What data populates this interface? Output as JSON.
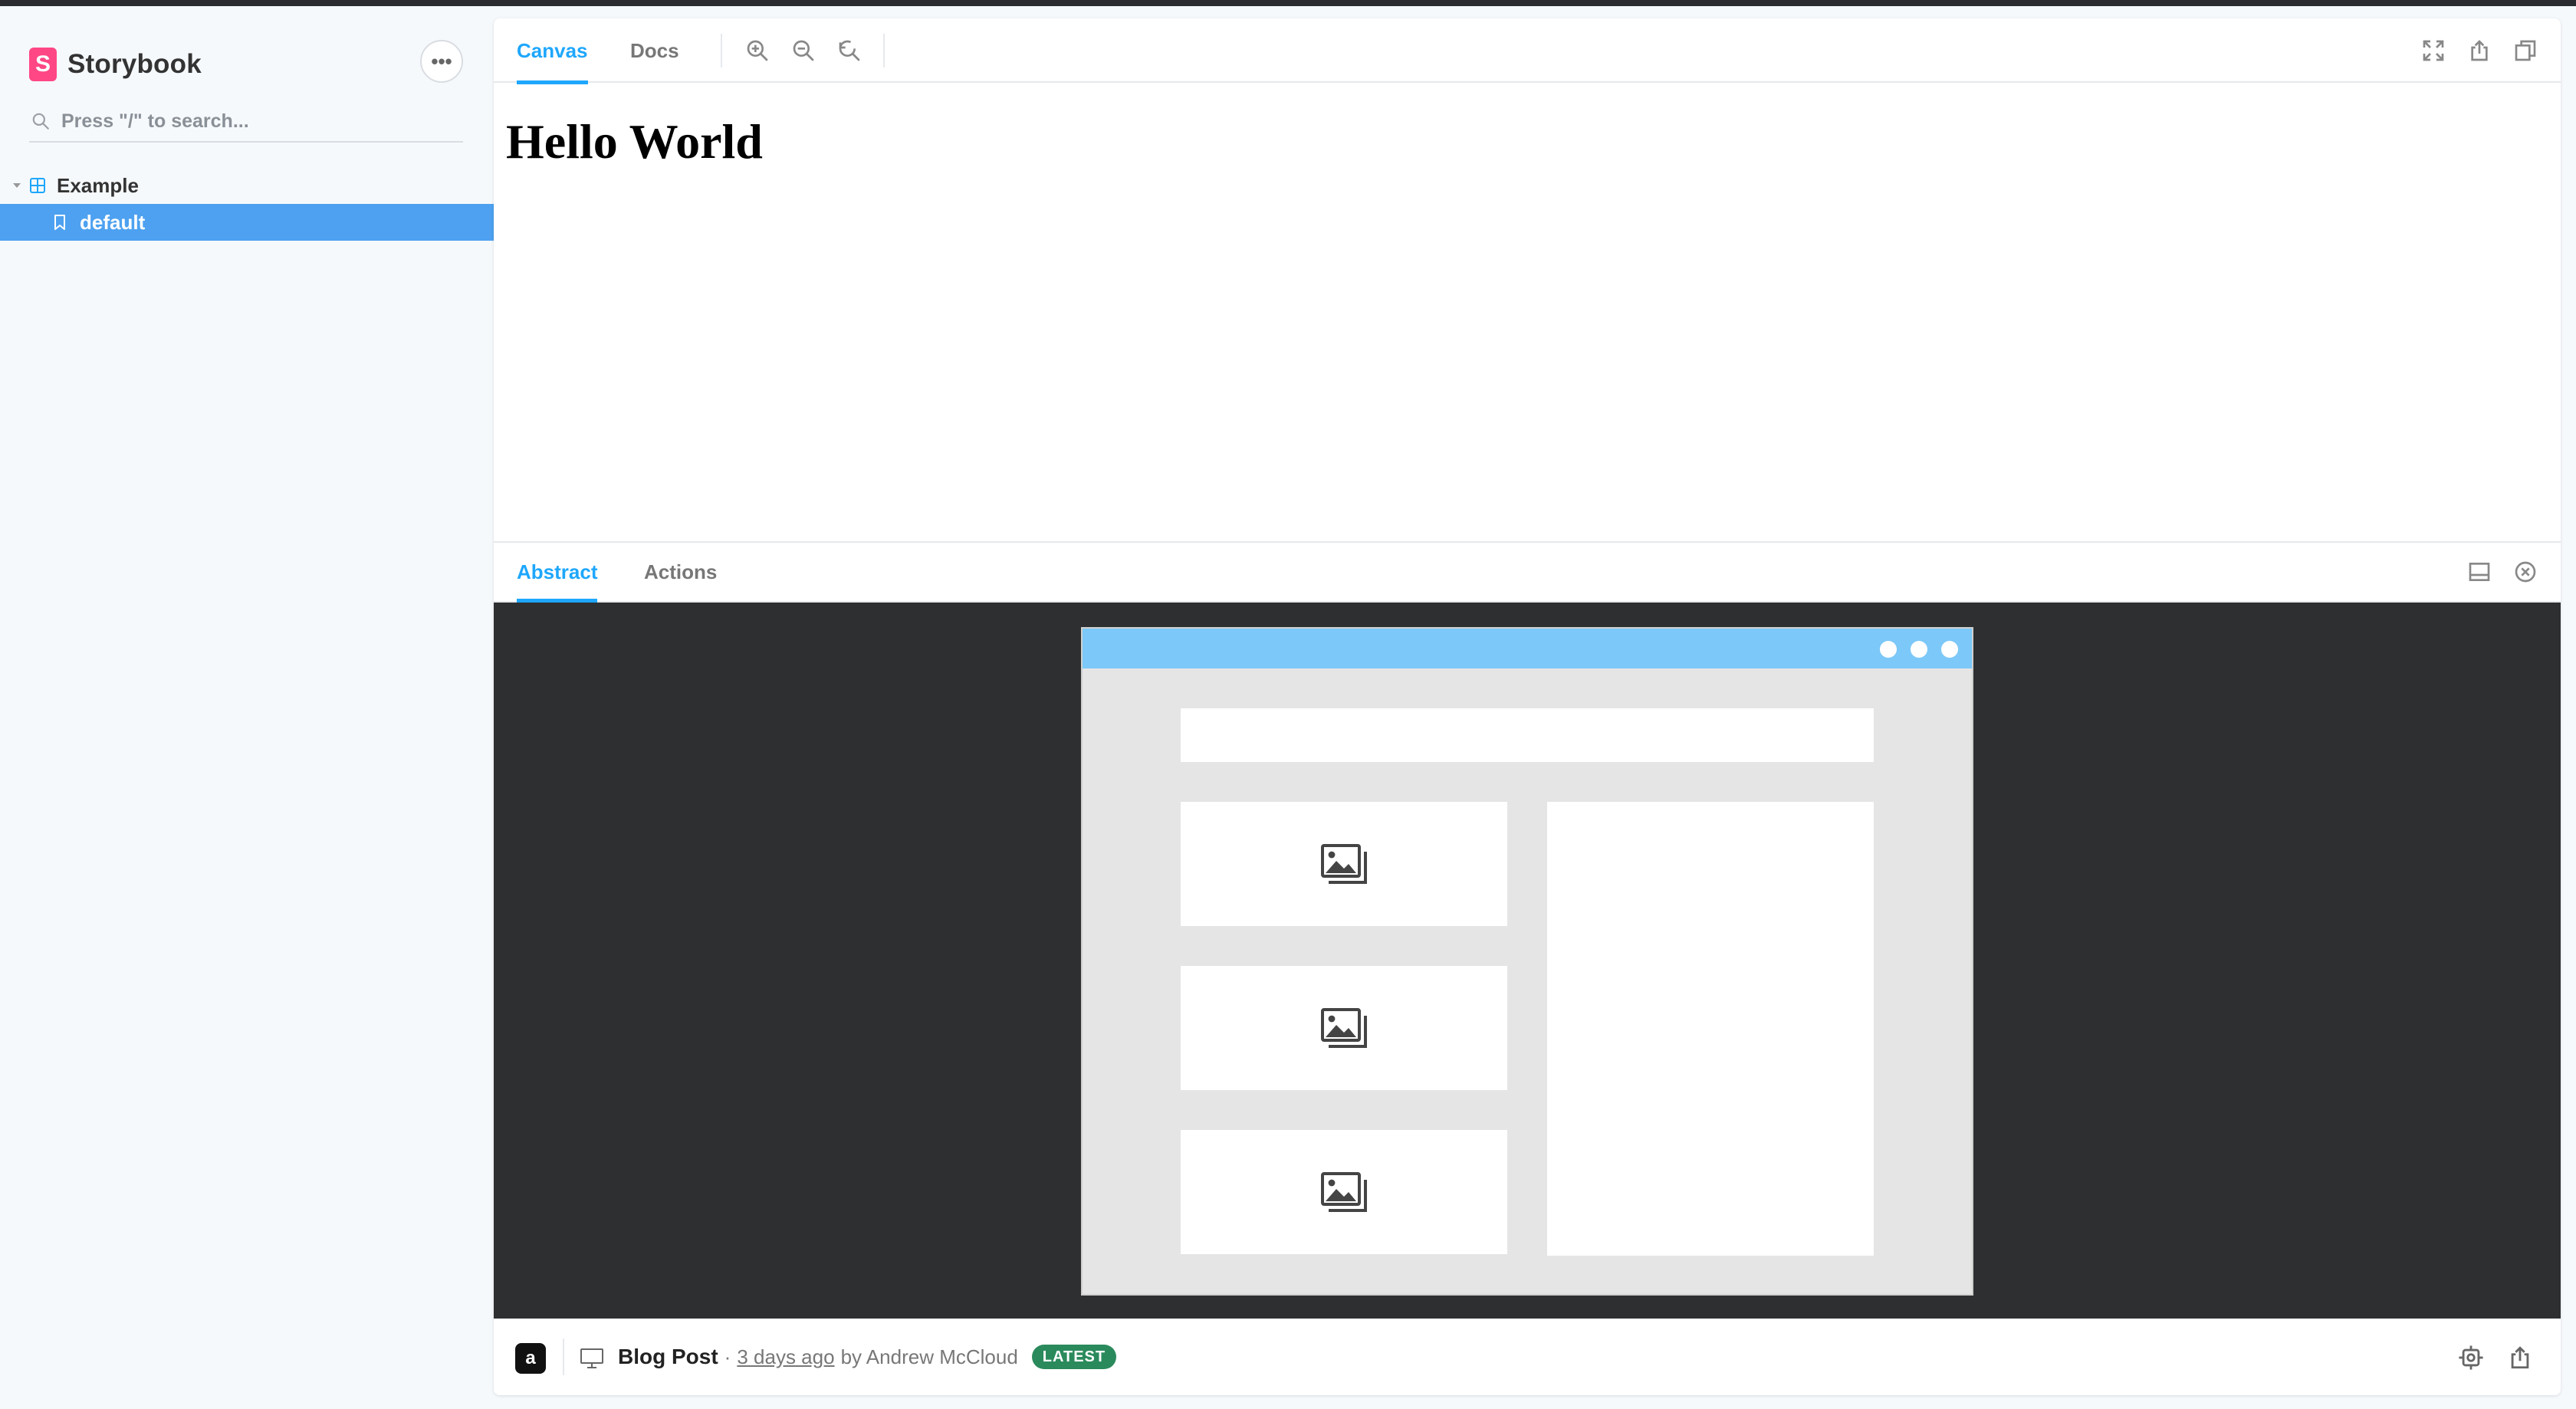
{
  "app": {
    "name": "Storybook"
  },
  "sidebar": {
    "menu_label": "•••",
    "search_placeholder": "Press \"/\" to search...",
    "group": {
      "label": "Example"
    },
    "items": [
      {
        "label": "default",
        "selected": true
      }
    ]
  },
  "toolbar": {
    "tabs": [
      {
        "label": "Canvas",
        "active": true
      },
      {
        "label": "Docs",
        "active": false
      }
    ],
    "icons": [
      "zoom-in-icon",
      "zoom-out-icon",
      "reset-zoom-icon",
      "fullscreen-icon",
      "share-icon",
      "copy-icon"
    ]
  },
  "canvas": {
    "heading": "Hello World"
  },
  "addons": {
    "tabs": [
      {
        "label": "Abstract",
        "active": true
      },
      {
        "label": "Actions",
        "active": false
      }
    ],
    "icons": [
      "panel-layout-icon",
      "close-panel-icon"
    ]
  },
  "abstract": {
    "logo_letter": "a",
    "title": "Blog Post",
    "separator": "·",
    "time_ago": "3 days ago",
    "by_text": "by Andrew McCloud",
    "badge": "LATEST"
  },
  "colors": {
    "accent": "#1ea7fd",
    "selected_bg": "#4da1f0",
    "brand": "#ff4785",
    "badge_green": "#2a8a5c",
    "abstract_bg": "#2e2f31",
    "mock_titlebar": "#7cc8f8"
  }
}
